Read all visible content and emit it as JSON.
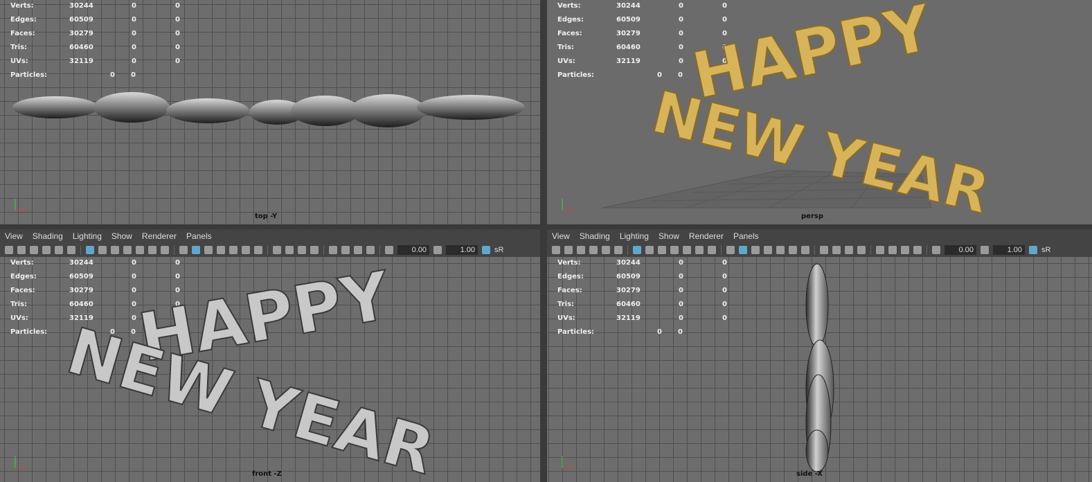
{
  "stats": {
    "verts_label": "Verts:",
    "verts": "30244",
    "verts_sel": "0",
    "verts_tri": "0",
    "edges_label": "Edges:",
    "edges": "60509",
    "edges_sel": "0",
    "edges_tri": "0",
    "faces_label": "Faces:",
    "faces": "30279",
    "faces_sel": "0",
    "faces_tri": "0",
    "tris_label": "Tris:",
    "tris": "60460",
    "tris_sel": "0",
    "tris_tri": "0",
    "uvs_label": "UVs:",
    "uvs": "32119",
    "uvs_sel": "0",
    "uvs_tri": "0",
    "particles_label": "Particles:",
    "particles_a": "0",
    "particles_b": "0"
  },
  "viewports": {
    "top": {
      "camera": "top -Y"
    },
    "persp": {
      "camera": "persp"
    },
    "front": {
      "camera": "front -Z"
    },
    "side": {
      "camera": "side -X"
    }
  },
  "menu": {
    "view": "View",
    "shading": "Shading",
    "lighting": "Lighting",
    "show": "Show",
    "renderer": "Renderer",
    "panels": "Panels"
  },
  "toolbar": {
    "exposure": "0.00",
    "gamma": "1.00",
    "color_space": "sR"
  },
  "scene": {
    "line1": "HAPPY",
    "line2": "NEW YEAR",
    "gold_color": "#d7b45a",
    "silver_color": "#c8c8c8"
  }
}
